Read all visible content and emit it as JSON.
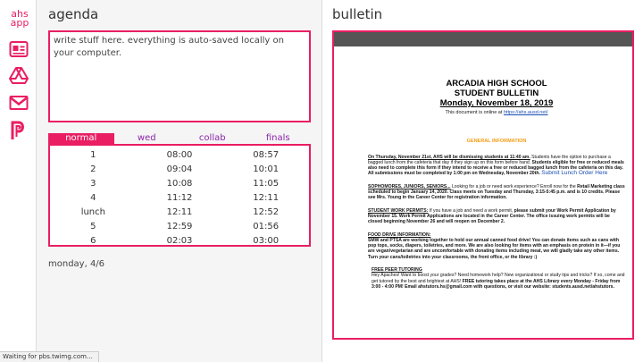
{
  "app": {
    "logo_line1": "ahs",
    "logo_line2": "app"
  },
  "sidebar": {
    "icons": [
      {
        "name": "id-card-icon"
      },
      {
        "name": "google-drive-icon"
      },
      {
        "name": "gmail-icon"
      },
      {
        "name": "schoology-icon"
      }
    ]
  },
  "agenda": {
    "title": "agenda",
    "notes_text": "write stuff here. everything is auto-saved locally on your computer.",
    "tabs": [
      {
        "label": "normal",
        "active": true
      },
      {
        "label": "wed",
        "active": false
      },
      {
        "label": "collab",
        "active": false
      },
      {
        "label": "finals",
        "active": false
      }
    ],
    "schedule": [
      {
        "period": "1",
        "start": "08:00",
        "end": "08:57"
      },
      {
        "period": "2",
        "start": "09:04",
        "end": "10:01"
      },
      {
        "period": "3",
        "start": "10:08",
        "end": "11:05"
      },
      {
        "period": "4",
        "start": "11:12",
        "end": "12:11"
      },
      {
        "period": "lunch",
        "start": "12:11",
        "end": "12:52"
      },
      {
        "period": "5",
        "start": "12:59",
        "end": "01:56"
      },
      {
        "period": "6",
        "start": "02:03",
        "end": "03:00"
      }
    ],
    "date": "monday, 4/6"
  },
  "bulletin": {
    "title": "bulletin",
    "school": "ARCADIA HIGH SCHOOL",
    "heading": "STUDENT BULLETIN",
    "date": "Monday, November 18, 2019",
    "online_prefix": "This document is online at ",
    "online_link": "https://ahs.ausd.net/",
    "section": "GENERAL INFORMATION",
    "p1_lead": "On Thursday, November 21st, AHS will be dismissing students at 11:40 am.",
    "p1_rest": " Students have the option to purchase a bagged lunch from the cafeteria that day if they sign up on this form before hand. ",
    "p1_bold": "Students eligible for free or reduced meals also need to complete this form if they intend to receive a free or reduced bagged lunch from the cafeteria on this day. All submissions must be completed by 1:00 pm on Wednesday, November 20th.",
    "p1_link": "Submit Lunch Order Here",
    "p2_lead": "SOPHOMORES, JUNIORS, SENIORS...",
    "p2_rest": " Looking for a job or need work experience? Enroll now for the ",
    "p2_bold": "Retail Marketing class scheduled to begin January 14, 2020. Class meets on Tuesday and Thursday, 3:15-5:45 p.m. and is 10 credits. Please see Mrs. Young in the Career Center for registration information.",
    "p3_lead": "STUDENT WORK PERMITS:",
    "p3_rest": " If you have a job and need a work permit, ",
    "p3_bold": "please submit your Work Permit Application by November 15. Work Permit Applications are located in the Career Center. The office issuing work permits will be closed beginning November 26 and will reopen on December 2.",
    "p4_lead": "FOOD DRIVE INFORMATION:",
    "p4_bold": "SMW and PTSA are working together to hold our annual canned food drive! You can donate items such as cans with pop tops, socks, diapers, toiletries, and more. We are also looking for items with an emphasis on protein in it—if you are vegan/vegetarian and are uncomfortable with donating items including meat, we will gladly take any other items. Turn your cans/toiletries into your classrooms, the front office, or the library :)",
    "p5_lead": "FREE PEER TUTORING",
    "p5_rest": "Hey Apaches! Want to boost your grades? Need homework help? New organizational or study tips and tricks? If so, come and get tutored by the best and brightest at AHS! ",
    "p5_bold": "FREE tutoring takes place at the AHS Library every Monday - Friday from 3:00 - 4:00 PM! Email ahstutors.hs@gmail.com with questions, or visit our website: students.ausd.net/ahstutors."
  },
  "status_bar": {
    "text": "Waiting for pbs.twimg.com..."
  },
  "colors": {
    "accent": "#e91e63",
    "tab_text": "#8e24aa"
  }
}
